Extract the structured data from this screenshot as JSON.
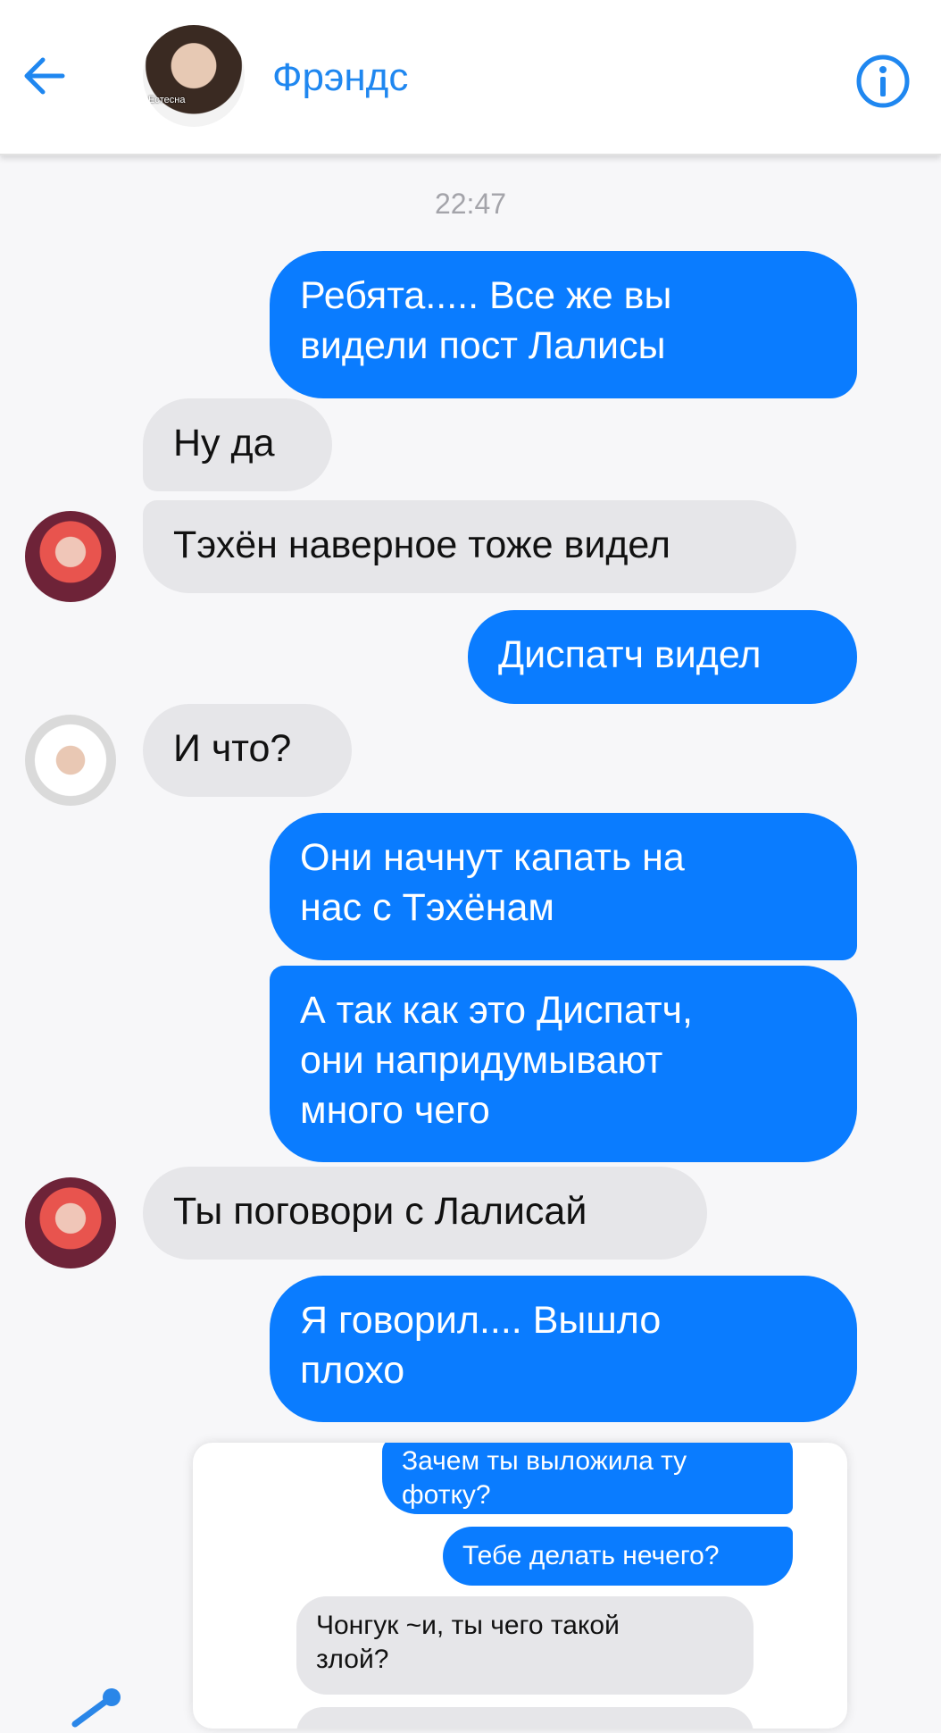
{
  "header": {
    "title": "Фрэндс",
    "avatar_caption": "Естесна",
    "back_icon": "arrow-left-icon",
    "info_icon": "info-icon"
  },
  "colors": {
    "accent": "#0a7cff",
    "incoming": "#e6e6e9",
    "title": "#1f87f0"
  },
  "timestamp": "22:47",
  "messages": [
    {
      "dir": "out",
      "lines": [
        "Ребята..... Все же вы",
        "видели пост Лалисы"
      ]
    },
    {
      "dir": "in",
      "lines": [
        "Ну да"
      ]
    },
    {
      "dir": "in",
      "lines": [
        "Тэхён наверное тоже видел"
      ]
    },
    {
      "dir": "out",
      "lines": [
        "Диспатч видел"
      ]
    },
    {
      "dir": "in",
      "lines": [
        "И что?"
      ]
    },
    {
      "dir": "out",
      "lines": [
        "Они начнут капать на",
        "нас с Тэхёнам"
      ]
    },
    {
      "dir": "out",
      "lines": [
        "А так как это Диспатч,",
        "они напридумывают",
        "много чего"
      ]
    },
    {
      "dir": "in",
      "lines": [
        "Ты поговори с Лалисай"
      ]
    },
    {
      "dir": "out",
      "lines": [
        "Я говорил.... Вышло",
        "плохо"
      ]
    }
  ],
  "embedded": {
    "messages": [
      {
        "dir": "out",
        "lines": [
          "Зачем ты выложила ту",
          "фотку?"
        ]
      },
      {
        "dir": "out",
        "lines": [
          "Тебе делать нечего?"
        ]
      },
      {
        "dir": "in",
        "lines": [
          "Чонгук ~и, ты чего такой",
          "злой?"
        ]
      }
    ]
  },
  "share_icon": "share-icon"
}
